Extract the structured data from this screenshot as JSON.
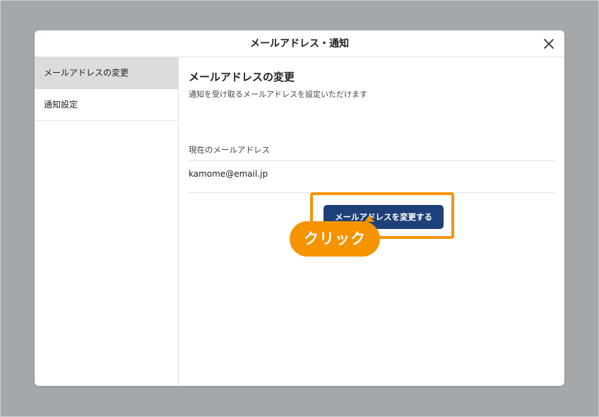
{
  "modal": {
    "title": "メールアドレス・通知",
    "close_icon": "close-icon"
  },
  "sidebar": {
    "items": [
      {
        "label": "メールアドレスの変更",
        "active": true
      },
      {
        "label": "通知設定",
        "active": false
      }
    ]
  },
  "content": {
    "section_title": "メールアドレスの変更",
    "description": "通知を受け取るメールアドレスを設定いただけます",
    "field_label": "現在のメールアドレス",
    "field_value": "kamome@email.jp",
    "button_label": "メールアドレスを変更する"
  },
  "annotation": {
    "callout_text": "クリック",
    "highlight_color": "#f59300"
  },
  "colors": {
    "backdrop": "#a4a8ab",
    "primary_button": "#1e4079",
    "active_sidebar": "#dcdcdc"
  }
}
